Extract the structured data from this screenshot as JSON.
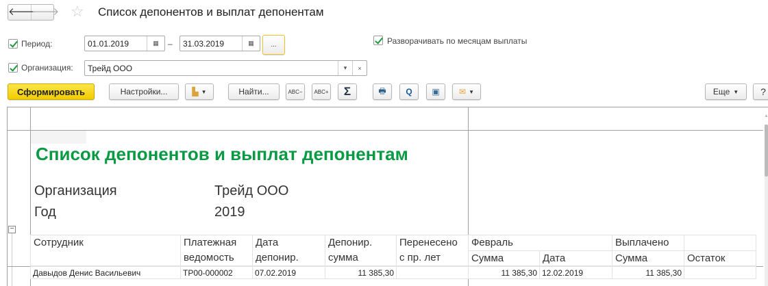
{
  "window": {
    "title": "Список депонентов и выплат депонентам"
  },
  "form": {
    "period_label": "Период:",
    "date_from": "01.01.2019",
    "dash": "–",
    "date_to": "31.03.2019",
    "period_btn": "...",
    "expand_label": "Разворачивать по  месяцам выплаты",
    "org_label": "Организация:",
    "org_value": "Трейд ООО"
  },
  "toolbar": {
    "generate": "Сформировать",
    "settings": "Настройки...",
    "find": "Найти...",
    "sum": "Σ",
    "more": "Еще",
    "help": "?"
  },
  "report": {
    "title": "Список депонентов и выплат депонентам",
    "org_label": "Организация",
    "org_value": "Трейд ООО",
    "year_label": "Год",
    "year_value": "2019",
    "headers": {
      "employee": "Сотрудник",
      "statement1": "Платежная",
      "statement2": "ведомость",
      "date1": "Дата",
      "date2": "депонир.",
      "amount1": "Депонир.",
      "amount2": "сумма",
      "carried1": "Перенесено",
      "carried2": "с пр. лет",
      "month": "Февраль",
      "month_sum": "Сумма",
      "month_date": "Дата",
      "paid": "Выплачено",
      "paid_sum": "Сумма",
      "balance": "Остаток"
    },
    "rows": [
      {
        "employee": "Давыдов Денис Васильевич",
        "statement": "ТР00-000002",
        "date": "07.02.2019",
        "amount": "11 385,30",
        "carried": "",
        "month_sum": "11 385,30",
        "month_date": "12.02.2019",
        "paid_sum": "11 385,30",
        "balance": ""
      }
    ]
  }
}
